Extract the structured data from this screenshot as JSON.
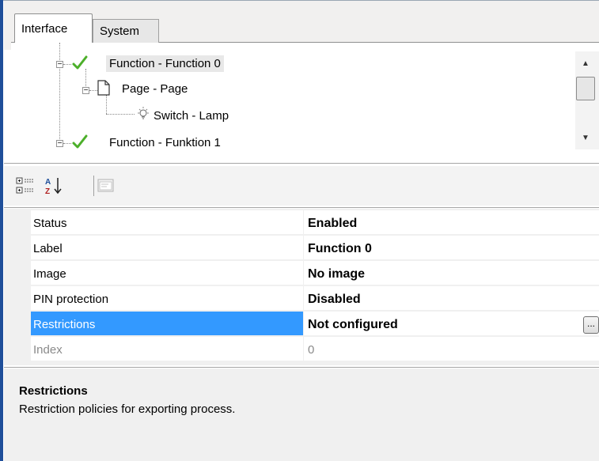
{
  "tabs": [
    {
      "label": "Interface",
      "active": true
    },
    {
      "label": "System",
      "active": false
    }
  ],
  "tree": {
    "items": [
      {
        "label": "Function - Function 0",
        "icon": "checkmark-icon",
        "selected": true
      },
      {
        "label": "Page - Page",
        "icon": "page-icon"
      },
      {
        "label": "Switch - Lamp",
        "icon": "lamp-icon"
      },
      {
        "label": "Function - Funktion 1",
        "icon": "checkmark-icon"
      }
    ]
  },
  "toolbar": {
    "categorized_icon": "categorized-view-icon",
    "alphabetical_icon": "sort-alphabetical-icon",
    "property_pages_icon": "property-pages-icon"
  },
  "properties": [
    {
      "name": "Status",
      "value": "Enabled"
    },
    {
      "name": "Label",
      "value": "Function 0"
    },
    {
      "name": "Image",
      "value": "No image"
    },
    {
      "name": "PIN protection",
      "value": "Disabled"
    },
    {
      "name": "Restrictions",
      "value": "Not configured",
      "selected": true,
      "button": "..."
    },
    {
      "name": "Index",
      "value": "0",
      "disabled": true
    }
  ],
  "description": {
    "title": "Restrictions",
    "text": "Restriction policies for exporting process."
  },
  "colors": {
    "selection": "#3399ff",
    "check_green": "#4caf2a",
    "frame_accent": "#1f4f9a"
  }
}
